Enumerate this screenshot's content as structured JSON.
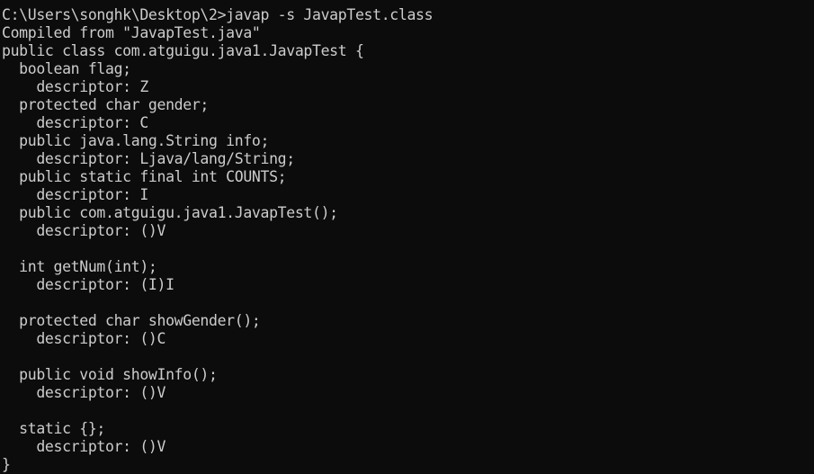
{
  "terminal": {
    "colors": {
      "background": "#0c0c0c",
      "foreground": "#cccccc"
    },
    "lines": [
      "C:\\Users\\songhk\\Desktop\\2>javap -s JavapTest.class",
      "Compiled from \"JavapTest.java\"",
      "public class com.atguigu.java1.JavapTest {",
      "  boolean flag;",
      "    descriptor: Z",
      "  protected char gender;",
      "    descriptor: C",
      "  public java.lang.String info;",
      "    descriptor: Ljava/lang/String;",
      "  public static final int COUNTS;",
      "    descriptor: I",
      "  public com.atguigu.java1.JavapTest();",
      "    descriptor: ()V",
      "",
      "  int getNum(int);",
      "    descriptor: (I)I",
      "",
      "  protected char showGender();",
      "    descriptor: ()C",
      "",
      "  public void showInfo();",
      "    descriptor: ()V",
      "",
      "  static {};",
      "    descriptor: ()V",
      "}"
    ]
  }
}
